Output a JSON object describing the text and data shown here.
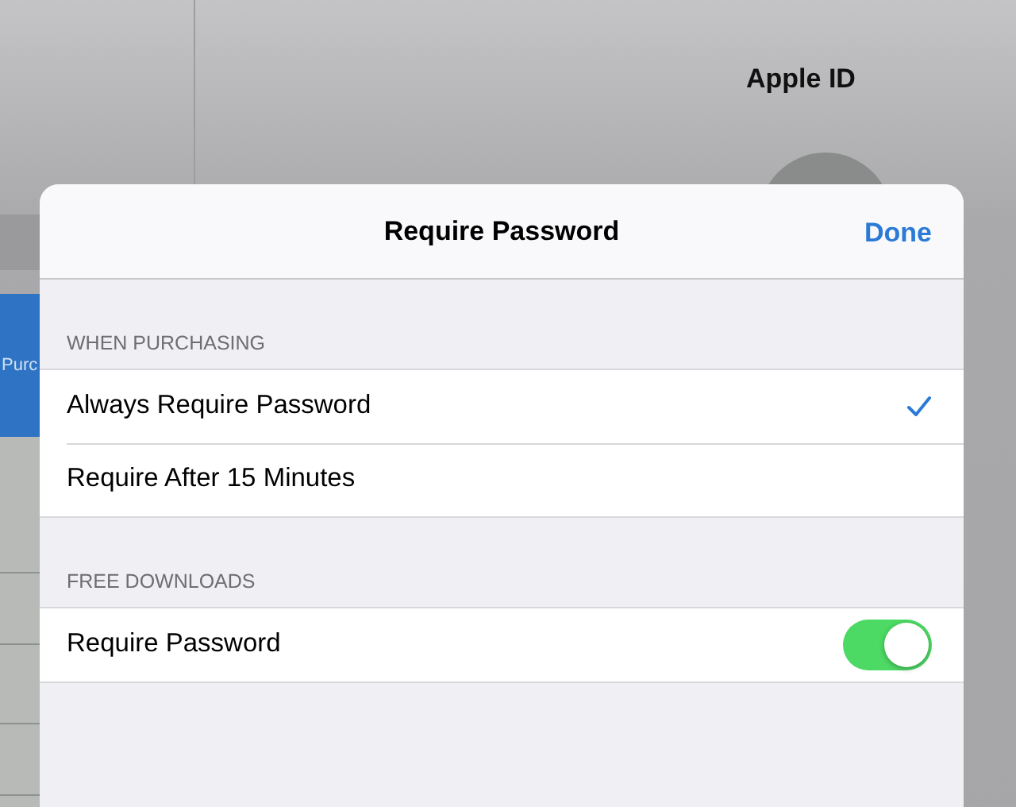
{
  "background": {
    "title": "Apple ID",
    "side_button": "Purc"
  },
  "sheet": {
    "title": "Require Password",
    "done": "Done",
    "sections": [
      {
        "header": "WHEN PURCHASING",
        "rows": [
          {
            "kind": "choice",
            "label": "Always Require Password",
            "selected": true
          },
          {
            "kind": "choice",
            "label": "Require After 15 Minutes",
            "selected": false
          }
        ]
      },
      {
        "header": "FREE DOWNLOADS",
        "rows": [
          {
            "kind": "switch",
            "label": "Require Password",
            "on": true
          }
        ]
      }
    ]
  }
}
